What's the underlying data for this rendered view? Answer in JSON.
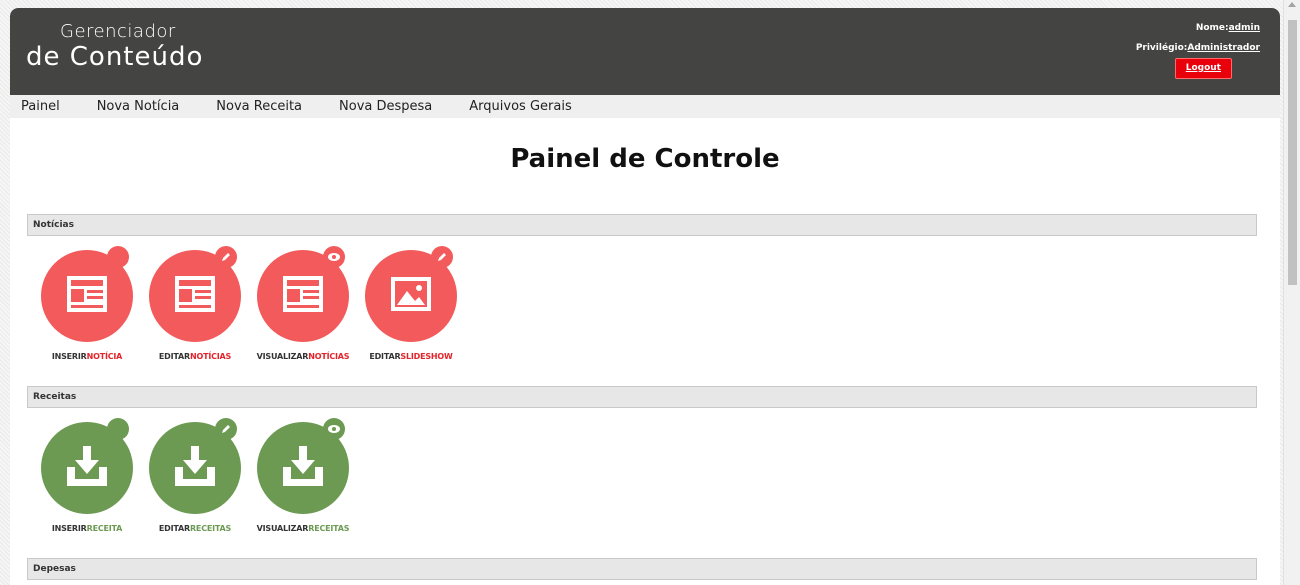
{
  "header": {
    "logo_small": "Gerenciador",
    "logo_big": "de Conteúdo",
    "user_label": "Nome:",
    "user_name": "admin",
    "privilege_label": "Privilégio:",
    "privilege_value": "Administrador",
    "logout_label": "Logout"
  },
  "nav": [
    "Painel",
    "Nova Notícia",
    "Nova Receita",
    "Nova Despesa",
    "Arquivos Gerais"
  ],
  "page_title": "Painel de Controle",
  "sections": [
    {
      "title": "Notícias",
      "color": "red",
      "items": [
        {
          "verb": "INSERIR",
          "object": "NOTÍCIA",
          "badge": "plus",
          "glyph": "newspaper"
        },
        {
          "verb": "EDITAR",
          "object": "NOTÍCIAS",
          "badge": "pencil",
          "glyph": "newspaper"
        },
        {
          "verb": "VISUALIZAR",
          "object": "NOTÍCIAS",
          "badge": "eye",
          "glyph": "newspaper"
        },
        {
          "verb": "EDITAR",
          "object": "SLIDESHOW",
          "badge": "pencil",
          "glyph": "image"
        }
      ]
    },
    {
      "title": "Receitas",
      "color": "green",
      "items": [
        {
          "verb": "INSERIR",
          "object": "RECEITA",
          "badge": "plus",
          "glyph": "download"
        },
        {
          "verb": "EDITAR",
          "object": "RECEITAS",
          "badge": "pencil",
          "glyph": "download"
        },
        {
          "verb": "VISUALIZAR",
          "object": "RECEITAS",
          "badge": "eye",
          "glyph": "download"
        }
      ]
    },
    {
      "title": "Depesas",
      "color": "red",
      "items": []
    }
  ],
  "colors": {
    "red": "#f25a5b",
    "green": "#6c9a53",
    "header": "#444443",
    "logout": "#e8000b"
  }
}
